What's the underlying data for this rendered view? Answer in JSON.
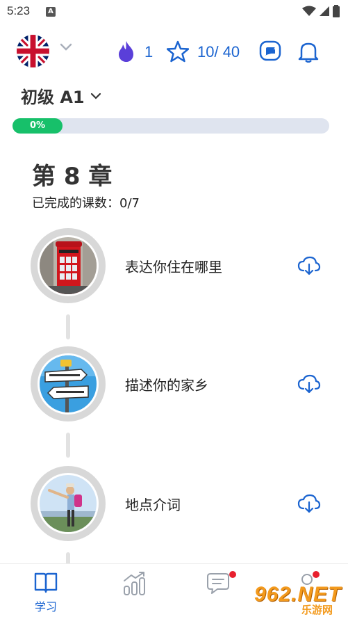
{
  "status_bar": {
    "time": "5:23",
    "notification_letter": "A"
  },
  "header": {
    "language": "English (UK)",
    "streak_count": "1",
    "stars_count": "10/ 40"
  },
  "level": {
    "label": "初级 A1",
    "progress_text": "0%",
    "progress_fraction": 0.0
  },
  "chapter": {
    "title": "第 8 章",
    "completed_text": "已完成的课数：0/7"
  },
  "lessons": [
    {
      "title": "表达你住在哪里",
      "image": "red-phone-booth"
    },
    {
      "title": "描述你的家乡",
      "image": "road-signs"
    },
    {
      "title": "地点介词",
      "image": "hiker-pointing"
    }
  ],
  "bottom_nav": {
    "learn_label": "学习"
  },
  "watermark": {
    "main": "962.NET",
    "sub": "乐游网"
  },
  "colors": {
    "accent": "#1b64d0",
    "progress": "#17c06a",
    "streak": "#5a3fd9",
    "badge": "#e8202e"
  }
}
